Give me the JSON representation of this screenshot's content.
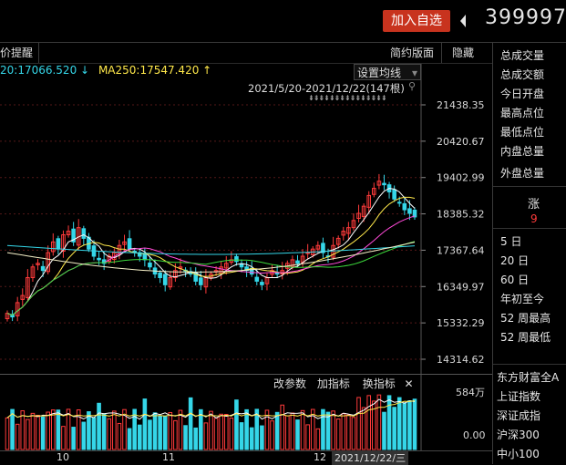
{
  "topbar": {
    "add_watchlist": "加入自选",
    "stock_code": "399997"
  },
  "subbar": {
    "left_label": "价提醒",
    "simple_page": "简约版面",
    "hide": "隐藏"
  },
  "ma_line": {
    "ma_prev": "20:17066.520",
    "ma_prev_arrow": "↓",
    "ma250": "MA250:17547.420",
    "ma250_arrow": "↑",
    "set_ma": "设置均线",
    "range": "2021/5/20-2021/12/22(147根)"
  },
  "y_axis": [
    "21438.35",
    "20420.67",
    "19402.99",
    "18385.32",
    "17367.64",
    "16349.97",
    "15332.29",
    "14314.62"
  ],
  "vol_toolbar": {
    "change_params": "改参数",
    "add_indicator": "加指标",
    "switch_indicator": "换指标",
    "close": "✕"
  },
  "vol_axis": {
    "top": "584万",
    "bottom": "0.00"
  },
  "x_axis": {
    "m10": "10",
    "m11": "11",
    "m12": "12",
    "current": "2021/12/22/三"
  },
  "right_panel": {
    "items": [
      "总成交量",
      "总成交额",
      "今日开盘",
      "最高点位",
      "最低点位",
      "内盘总量",
      "外盘总量"
    ],
    "change_label": "涨",
    "change_value": "9",
    "periods": [
      "5 日",
      "20 日",
      "60 日",
      "年初至今",
      "52 周最高",
      "52 周最低"
    ],
    "indices": [
      "东方财富全A",
      "上证指数",
      "深证成指",
      "沪深300",
      "中小100"
    ]
  },
  "colors": {
    "up": "#ff3b3b",
    "down": "#35d6e8",
    "accent": "#c8331e",
    "ma5": "#ffffff",
    "ma10": "#ffe84a",
    "ma20": "#ff4ad8",
    "ma60": "#3cd93c",
    "ma120": "#35d6e8"
  },
  "chart_data": {
    "type": "candlestick",
    "x_range": [
      "2021/5/20",
      "2021/12/22"
    ],
    "bar_count": 147,
    "ylim": [
      14314.62,
      21438.35
    ],
    "y_ticks": [
      21438.35,
      20420.67,
      19402.99,
      18385.32,
      17367.64,
      16349.97,
      15332.29,
      14314.62
    ],
    "x_ticks": [
      "10",
      "11",
      "12"
    ],
    "ma_labels": {
      "ma20_partial": 17066.52,
      "ma250": 17547.42
    },
    "close": [
      15600,
      15500,
      15900,
      16100,
      16600,
      16900,
      17000,
      16800,
      17300,
      17600,
      17400,
      17800,
      17900,
      17600,
      18000,
      17700,
      17400,
      17200,
      17100,
      17000,
      17200,
      17300,
      17500,
      17600,
      17400,
      17300,
      17200,
      17100,
      16900,
      16700,
      16600,
      16400,
      16600,
      16800,
      16900,
      16800,
      16700,
      16500,
      16400,
      16600,
      16700,
      16800,
      16900,
      17000,
      17100,
      17050,
      16900,
      16800,
      16700,
      16500,
      16400,
      16600,
      16800,
      16700,
      16800,
      17000,
      17100,
      17000,
      17200,
      17300,
      17400,
      17500,
      17300,
      17200,
      17500,
      17700,
      17900,
      18000,
      18200,
      18400,
      18600,
      18900,
      19100,
      19300,
      19200,
      19000,
      18800,
      18700,
      18500,
      18400,
      18300
    ],
    "volume_max": "584万"
  }
}
